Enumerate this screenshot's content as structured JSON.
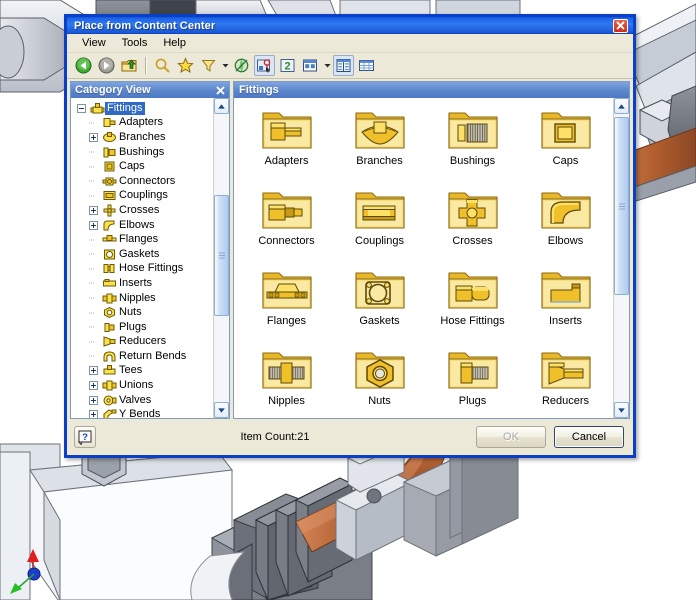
{
  "window": {
    "title": "Place from Content Center",
    "close_icon": "close-x-icon"
  },
  "menubar": {
    "items": [
      {
        "label": "View"
      },
      {
        "label": "Tools"
      },
      {
        "label": "Help"
      }
    ]
  },
  "toolbar": {
    "buttons": [
      {
        "name": "back-icon",
        "tip": "Back"
      },
      {
        "name": "forward-icon",
        "tip": "Forward"
      },
      {
        "name": "up-one-level-icon",
        "tip": "Up One Level"
      },
      {
        "name": "search-icon",
        "tip": "Search"
      },
      {
        "name": "favorites-star-icon",
        "tip": "Favorites"
      },
      {
        "name": "filter-funnel-icon",
        "tip": "Filter"
      },
      {
        "name": "refresh-globe-icon",
        "tip": "Refresh"
      },
      {
        "name": "category-view-icon",
        "tip": "Category View",
        "pressed": true
      },
      {
        "name": "part-view-icon",
        "tip": "Part View"
      },
      {
        "name": "thumbnail-view-icon",
        "tip": "Thumbnail View"
      },
      {
        "name": "list-view-icon",
        "tip": "List View",
        "pressed": true
      },
      {
        "name": "table-view-icon",
        "tip": "Table View"
      }
    ]
  },
  "left_panel": {
    "title": "Category View",
    "close_icon": "panel-close-icon",
    "tree": [
      {
        "label": "Fittings",
        "icon": "fittings-icon",
        "level": 0,
        "expander": "minus",
        "selected": true
      },
      {
        "label": "Adapters",
        "icon": "adapters-icon",
        "level": 1,
        "expander": "none"
      },
      {
        "label": "Branches",
        "icon": "branches-icon",
        "level": 1,
        "expander": "plus"
      },
      {
        "label": "Bushings",
        "icon": "bushings-icon",
        "level": 1,
        "expander": "none"
      },
      {
        "label": "Caps",
        "icon": "caps-icon",
        "level": 1,
        "expander": "none"
      },
      {
        "label": "Connectors",
        "icon": "connectors-icon",
        "level": 1,
        "expander": "none"
      },
      {
        "label": "Couplings",
        "icon": "couplings-icon",
        "level": 1,
        "expander": "none"
      },
      {
        "label": "Crosses",
        "icon": "crosses-icon",
        "level": 1,
        "expander": "plus"
      },
      {
        "label": "Elbows",
        "icon": "elbows-icon",
        "level": 1,
        "expander": "plus"
      },
      {
        "label": "Flanges",
        "icon": "flanges-icon",
        "level": 1,
        "expander": "none"
      },
      {
        "label": "Gaskets",
        "icon": "gaskets-icon",
        "level": 1,
        "expander": "none"
      },
      {
        "label": "Hose Fittings",
        "icon": "hose-fittings-icon",
        "level": 1,
        "expander": "none"
      },
      {
        "label": "Inserts",
        "icon": "inserts-icon",
        "level": 1,
        "expander": "none"
      },
      {
        "label": "Nipples",
        "icon": "nipples-icon",
        "level": 1,
        "expander": "none"
      },
      {
        "label": "Nuts",
        "icon": "nuts-icon",
        "level": 1,
        "expander": "none"
      },
      {
        "label": "Plugs",
        "icon": "plugs-icon",
        "level": 1,
        "expander": "none"
      },
      {
        "label": "Reducers",
        "icon": "reducers-icon",
        "level": 1,
        "expander": "none"
      },
      {
        "label": "Return Bends",
        "icon": "return-bends-icon",
        "level": 1,
        "expander": "none"
      },
      {
        "label": "Tees",
        "icon": "tees-icon",
        "level": 1,
        "expander": "plus"
      },
      {
        "label": "Unions",
        "icon": "unions-icon",
        "level": 1,
        "expander": "plus"
      },
      {
        "label": "Valves",
        "icon": "valves-icon",
        "level": 1,
        "expander": "plus"
      },
      {
        "label": "Y Bends",
        "icon": "y-bends-icon",
        "level": 1,
        "expander": "plus"
      }
    ],
    "scrollbar": {
      "up_icon": "scroll-up-icon",
      "down_icon": "scroll-down-icon"
    }
  },
  "right_panel": {
    "title": "Fittings",
    "items": [
      {
        "label": "Adapters",
        "icon": "folder-adapters-icon"
      },
      {
        "label": "Branches",
        "icon": "folder-branches-icon"
      },
      {
        "label": "Bushings",
        "icon": "folder-bushings-icon"
      },
      {
        "label": "Caps",
        "icon": "folder-caps-icon"
      },
      {
        "label": "Connectors",
        "icon": "folder-connectors-icon"
      },
      {
        "label": "Couplings",
        "icon": "folder-couplings-icon"
      },
      {
        "label": "Crosses",
        "icon": "folder-crosses-icon"
      },
      {
        "label": "Elbows",
        "icon": "folder-elbows-icon"
      },
      {
        "label": "Flanges",
        "icon": "folder-flanges-icon"
      },
      {
        "label": "Gaskets",
        "icon": "folder-gaskets-icon"
      },
      {
        "label": "Hose Fittings",
        "icon": "folder-hose-fittings-icon"
      },
      {
        "label": "Inserts",
        "icon": "folder-inserts-icon"
      },
      {
        "label": "Nipples",
        "icon": "folder-nipples-icon"
      },
      {
        "label": "Nuts",
        "icon": "folder-nuts-icon"
      },
      {
        "label": "Plugs",
        "icon": "folder-plugs-icon"
      },
      {
        "label": "Reducers",
        "icon": "folder-reducers-icon"
      }
    ],
    "scrollbar": {
      "up_icon": "scroll-up-icon",
      "down_icon": "scroll-down-icon"
    }
  },
  "footer": {
    "help_label": "?",
    "item_count": "Item Count:21",
    "ok_label": "OK",
    "ok_enabled": false,
    "cancel_label": "Cancel"
  },
  "colors": {
    "titlebar_blue": "#1d64e8",
    "dialog_border": "#0a3fc8",
    "panel_header": "#5c86cc",
    "dialog_face": "#ece9d8",
    "selection": "#316ac5",
    "folder_yellow": "#f5d24a",
    "pipe_copper": "#b5seats"
  },
  "background_scene": {
    "description": "CAD assembly view",
    "axis_indicator": {
      "x_color": "#d92b2b",
      "y_color": "#1a3fd0",
      "z_color": "#18c020"
    }
  }
}
